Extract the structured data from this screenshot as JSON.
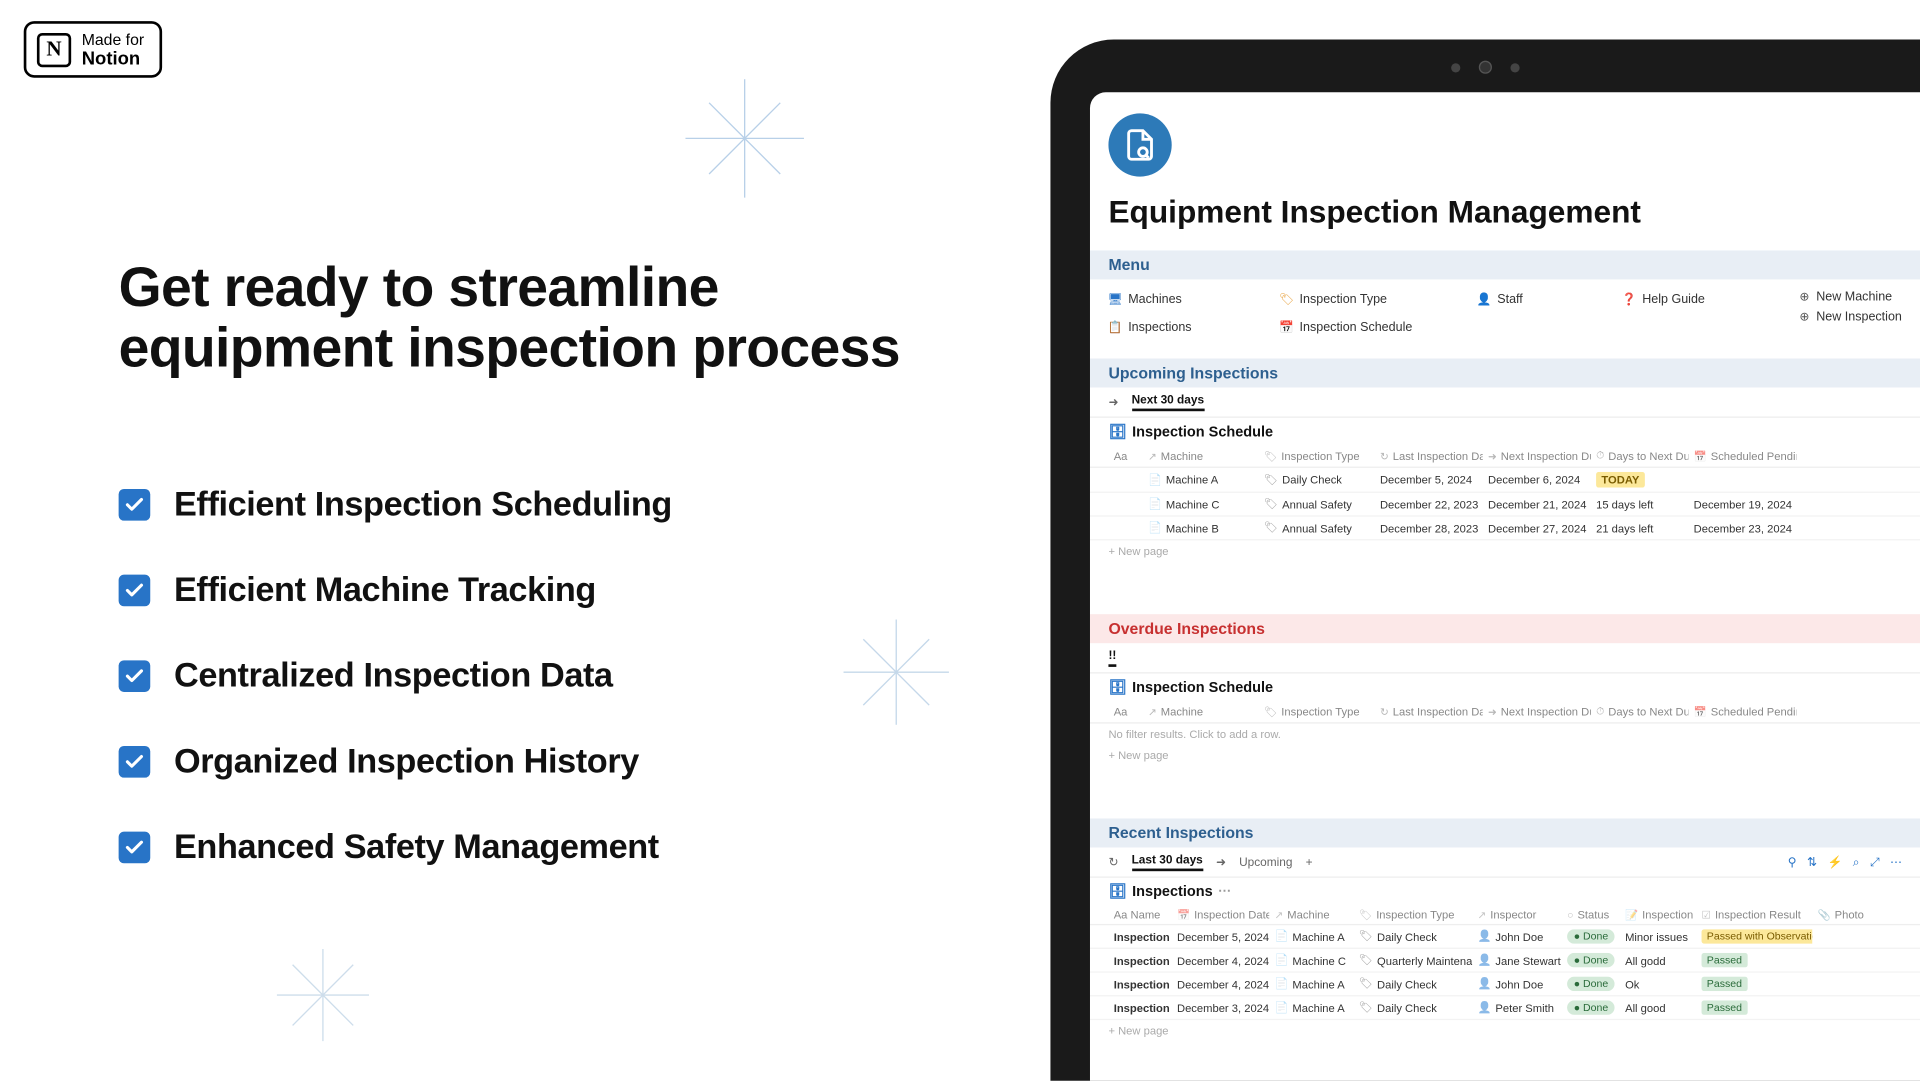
{
  "badge": {
    "icon_letter": "N",
    "top": "Made for",
    "bottom": "Notion"
  },
  "headline": "Get ready to streamline equipment inspection process",
  "features": [
    "Efficient Inspection Scheduling",
    "Efficient Machine Tracking",
    "Centralized Inspection Data",
    "Organized Inspection History",
    "Enhanced Safety Management"
  ],
  "app": {
    "title": "Equipment Inspection Management",
    "menu_label": "Menu",
    "menu_items": [
      {
        "icon": "machines",
        "label": "Machines"
      },
      {
        "icon": "inspections",
        "label": "Inspections"
      },
      {
        "icon": "type",
        "label": "Inspection Type"
      },
      {
        "icon": "schedule",
        "label": "Inspection Schedule"
      },
      {
        "icon": "staff",
        "label": "Staff"
      },
      {
        "icon": "help",
        "label": "Help Guide"
      }
    ],
    "menu_actions": [
      {
        "icon": "plus",
        "label": "New Machine"
      },
      {
        "icon": "plus",
        "label": "New Inspection"
      }
    ],
    "upcoming": {
      "title": "Upcoming Inspections",
      "tab": "Next 30 days",
      "db": "Inspection Schedule",
      "cols": [
        "Aa",
        "Machine",
        "Inspection Type",
        "Last Inspection Date",
        "Next Inspection Due",
        "Days to Next Due",
        "Scheduled Pending"
      ],
      "rows": [
        {
          "machine": "Machine A",
          "type": "Daily Check",
          "last": "December 5, 2024",
          "next": "December 6, 2024",
          "days": "TODAY",
          "days_style": "today",
          "sched": ""
        },
        {
          "machine": "Machine C",
          "type": "Annual Safety",
          "last": "December 22, 2023",
          "next": "December 21, 2024",
          "days": "15 days left",
          "sched": "December 19, 2024"
        },
        {
          "machine": "Machine B",
          "type": "Annual Safety",
          "last": "December 28, 2023",
          "next": "December 27, 2024",
          "days": "21 days left",
          "sched": "December 23, 2024"
        }
      ],
      "newpage": "+ New page"
    },
    "overdue": {
      "title": "Overdue Inspections",
      "tab": "!!",
      "db": "Inspection Schedule",
      "cols": [
        "Aa",
        "Machine",
        "Inspection Type",
        "Last Inspection Date",
        "Next Inspection Due",
        "Days to Next Due",
        "Scheduled Pending"
      ],
      "empty": "No filter results. Click to add a row.",
      "newpage": "+ New page"
    },
    "recent": {
      "title": "Recent Inspections",
      "tabs": [
        "Last 30 days",
        "Upcoming"
      ],
      "db": "Inspections",
      "cols": [
        "Aa Name",
        "Inspection Date",
        "Machine",
        "Inspection Type",
        "Inspector",
        "Status",
        "Inspection Notes",
        "Inspection Result",
        "Photo"
      ],
      "rows": [
        {
          "name": "Inspection",
          "date": "December 5, 2024",
          "machine": "Machine A",
          "type": "Daily Check",
          "inspector": "John Doe",
          "status": "Done",
          "notes": "Minor issues",
          "result": "Passed with Observations",
          "res_style": "obs"
        },
        {
          "name": "Inspection",
          "date": "December 4, 2024",
          "machine": "Machine C",
          "type": "Quarterly Maintenance",
          "inspector": "Jane Stewart",
          "status": "Done",
          "notes": "All godd",
          "result": "Passed",
          "res_style": "passed"
        },
        {
          "name": "Inspection",
          "date": "December 4, 2024",
          "machine": "Machine A",
          "type": "Daily Check",
          "inspector": "John Doe",
          "status": "Done",
          "notes": "Ok",
          "result": "Passed",
          "res_style": "passed"
        },
        {
          "name": "Inspection",
          "date": "December 3, 2024",
          "machine": "Machine A",
          "type": "Daily Check",
          "inspector": "Peter Smith",
          "status": "Done",
          "notes": "All good",
          "result": "Passed",
          "res_style": "passed"
        }
      ],
      "newpage": "+ New page"
    }
  }
}
